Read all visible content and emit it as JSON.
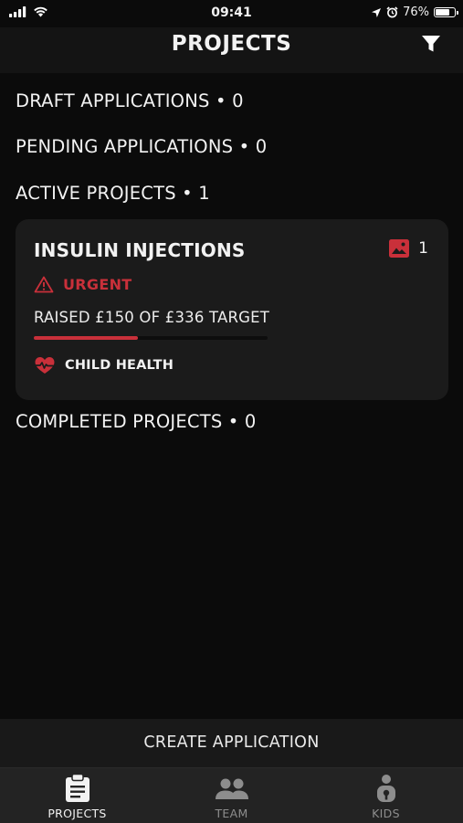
{
  "status_bar": {
    "time": "09:41",
    "battery": "76%",
    "battery_fraction": 0.76
  },
  "header": {
    "title": "PROJECTS",
    "filter_icon": "filter-icon"
  },
  "sections": {
    "draft": "DRAFT APPLICATIONS • 0",
    "pending": "PENDING APPLICATIONS • 0",
    "active": "ACTIVE PROJECTS • 1",
    "completed": "COMPLETED PROJECTS • 0"
  },
  "project_card": {
    "title": "INSULIN INJECTIONS",
    "photo_count": "1",
    "urgency": "URGENT",
    "raised_text": "RAISED £150 OF £336 TARGET",
    "progress_fraction": 0.446,
    "category": "CHILD HEALTH",
    "accent_color": "#c9303a"
  },
  "create_button": "CREATE APPLICATION",
  "tabs": [
    {
      "label": "PROJECTS",
      "icon": "clipboard-icon",
      "active": true
    },
    {
      "label": "TEAM",
      "icon": "people-icon",
      "active": false
    },
    {
      "label": "KIDS",
      "icon": "child-icon",
      "active": false
    }
  ]
}
